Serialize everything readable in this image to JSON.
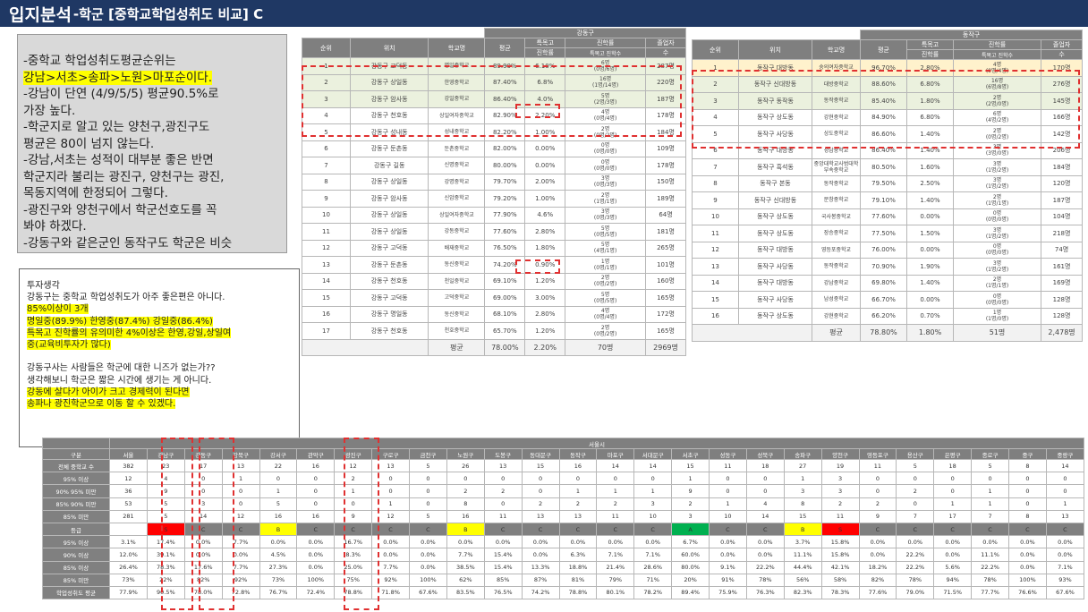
{
  "title": {
    "main": "입지분석",
    "sub": "-학군 [중학교학업성취도 비교] C"
  },
  "note": [
    "-중학교 학업성취도평균순위는",
    "강남>서초>송파>노원>마포순이다.",
    "-강남이 단연 (4/9/5/5) 평균90.5%로",
    "  가장 높다.",
    "-학군지로 알고 있는 양천구,광진구도",
    "  평균은 80이 넘지 않는다.",
    "-강남,서초는 성적이 대부분 좋은 반면",
    "  학군지라 불리는 광진구, 양천구는 광진,",
    "목동지역에 한정되어 그렇다.",
    "-광진구와 양천구에서 학군선호도를 꼭",
    "  봐야 하겠다.",
    "-강동구와 같은군인 동작구도 학군은 비슷"
  ],
  "investment": {
    "title": "투자생각",
    "lines": [
      "강동구는 중학교 학업성취도가 아주 좋은편은 아니다.",
      "85%이상이 3개",
      "명일중(89.9%) 한영중(87.4%) 강일중(86.4%)",
      "특목고 진학률의 유의미한 4%이상은 한영,강일,상일여",
      "중(교육비투자가 많다)",
      "",
      "강동구사는 사람들은 학군에 대한 니즈가 없는가??",
      "생각해보니 학군은 짧은 시간에 생기는 게 아니다.",
      "강동에 살다가 아이가 크고 경제력이 된다면",
      "송파나 광진학군으로 이동 할 수 있겠다."
    ]
  },
  "left_table": {
    "district": "강동구",
    "headers": {
      "rank": "순위",
      "loc": "위치",
      "school": "학교명",
      "avg": "평균",
      "special": "특목고",
      "special2": "진학률",
      "adv": "진학률",
      "adv2": "특목고 진학수",
      "adv3": "(과학고/외고국제고)",
      "grad": "졸업자",
      "grad2": "수"
    },
    "rows": [
      {
        "r": "1",
        "loc": "강동구 고덕동",
        "s": "명일중학교",
        "a": "89.90%",
        "p": "6.10%",
        "n": "6명",
        "n2": "(0명/6명)",
        "g": "287명"
      },
      {
        "r": "2",
        "loc": "강동구 상일동",
        "s": "한영중학교",
        "a": "87.40%",
        "p": "6.8%",
        "n": "16명",
        "n2": "(1명/14명)",
        "g": "220명"
      },
      {
        "r": "3",
        "loc": "강동구 암사동",
        "s": "강일중학교",
        "a": "86.40%",
        "p": "4.0%",
        "n": "5명",
        "n2": "(2명/3명)",
        "g": "187명"
      },
      {
        "r": "4",
        "loc": "강동구 천호동",
        "s": "상일여자중학교",
        "a": "82.90%",
        "p": "2.20%",
        "n": "4명",
        "n2": "(0명/4명)",
        "g": "178명"
      },
      {
        "r": "5",
        "loc": "강동구 성내동",
        "s": "성내중학교",
        "a": "82.20%",
        "p": "1.00%",
        "n": "2명",
        "n2": "(0명/2명)",
        "g": "184명"
      },
      {
        "r": "6",
        "loc": "강동구 둔촌동",
        "s": "둔촌중학교",
        "a": "82.00%",
        "p": "0.00%",
        "n": "0명",
        "n2": "(0명/0명)",
        "g": "109명"
      },
      {
        "r": "7",
        "loc": "강동구 길동",
        "s": "신명중학교",
        "a": "80.00%",
        "p": "0.00%",
        "n": "0명",
        "n2": "(0명/0명)",
        "g": "178명"
      },
      {
        "r": "8",
        "loc": "강동구 상일동",
        "s": "강명중학교",
        "a": "79.70%",
        "p": "2.00%",
        "n": "3명",
        "n2": "(0명/3명)",
        "g": "150명"
      },
      {
        "r": "9",
        "loc": "강동구 암사동",
        "s": "신암중학교",
        "a": "79.20%",
        "p": "1.00%",
        "n": "2명",
        "n2": "(1명/1명)",
        "g": "189명"
      },
      {
        "r": "10",
        "loc": "강동구 상일동",
        "s": "상일여자중학교",
        "a": "77.90%",
        "p": "4.6%",
        "n": "3명",
        "n2": "(0명/3명)",
        "g": "64명"
      },
      {
        "r": "11",
        "loc": "강동구 상일동",
        "s": "강동중학교",
        "a": "77.60%",
        "p": "2.80%",
        "n": "5명",
        "n2": "(0명/5명)",
        "g": "181명"
      },
      {
        "r": "12",
        "loc": "강동구 고덕동",
        "s": "배재중학교",
        "a": "76.50%",
        "p": "1.80%",
        "n": "5명",
        "n2": "(4명/1명)",
        "g": "265명"
      },
      {
        "r": "13",
        "loc": "강동구 둔촌동",
        "s": "동신중학교",
        "a": "74.20%",
        "p": "0.90%",
        "n": "1명",
        "n2": "(0명/1명)",
        "g": "101명"
      },
      {
        "r": "14",
        "loc": "강동구 천호동",
        "s": "천일중학교",
        "a": "69.10%",
        "p": "1.20%",
        "n": "2명",
        "n2": "(0명/2명)",
        "g": "160명"
      },
      {
        "r": "15",
        "loc": "강동구 고덕동",
        "s": "고덕중학교",
        "a": "69.00%",
        "p": "3.00%",
        "n": "5명",
        "n2": "(0명/5명)",
        "g": "165명"
      },
      {
        "r": "16",
        "loc": "강동구 명일동",
        "s": "동신중학교",
        "a": "68.10%",
        "p": "2.80%",
        "n": "4명",
        "n2": "(0명/4명)",
        "g": "172명"
      },
      {
        "r": "17",
        "loc": "강동구 천호동",
        "s": "천호중학교",
        "a": "65.70%",
        "p": "1.20%",
        "n": "2명",
        "n2": "(0명/2명)",
        "g": "165명"
      }
    ],
    "avg_label": "평균",
    "avg_val": "78.00%",
    "avg_p": "2.20%",
    "avg_n": "70명",
    "avg_g": "2969명"
  },
  "right_table": {
    "district": "동작구",
    "rows": [
      {
        "r": "1",
        "loc": "동작구 대방동",
        "s": "숭의여자중학교",
        "a": "96.70%",
        "p": "2.80%",
        "n": "4명",
        "n2": "(0명/4명)",
        "g": "170명"
      },
      {
        "r": "2",
        "loc": "동작구 신대방동",
        "s": "대방중학교",
        "a": "88.60%",
        "p": "6.80%",
        "n": "16명",
        "n2": "(6명/8명)",
        "g": "276명"
      },
      {
        "r": "3",
        "loc": "동작구 동작동",
        "s": "동작중학교",
        "a": "85.40%",
        "p": "1.80%",
        "n": "2명",
        "n2": "(2명/0명)",
        "g": "145명"
      },
      {
        "r": "4",
        "loc": "동작구 상도동",
        "s": "강현중학교",
        "a": "84.90%",
        "p": "6.80%",
        "n": "6명",
        "n2": "(4명/2명)",
        "g": "166명"
      },
      {
        "r": "5",
        "loc": "동작구 사당동",
        "s": "상도중학교",
        "a": "86.60%",
        "p": "1.40%",
        "n": "2명",
        "n2": "(0명/2명)",
        "g": "142명"
      },
      {
        "r": "6",
        "loc": "동작구 대방동",
        "s": "성남중학교",
        "a": "86.40%",
        "p": "1.40%",
        "n": "3명",
        "n2": "(3명/0명)",
        "g": "206명"
      },
      {
        "r": "7",
        "loc": "동작구 흑석동",
        "s": "중앙대학교사범대학부속중학교",
        "a": "80.50%",
        "p": "1.60%",
        "n": "3명",
        "n2": "(1명/2명)",
        "g": "184명"
      },
      {
        "r": "8",
        "loc": "동작구 본동",
        "s": "동작중학교",
        "a": "79.50%",
        "p": "2.50%",
        "n": "3명",
        "n2": "(1명/2명)",
        "g": "120명"
      },
      {
        "r": "9",
        "loc": "동작구 신대방동",
        "s": "문창중학교",
        "a": "79.10%",
        "p": "1.40%",
        "n": "2명",
        "n2": "(1명/1명)",
        "g": "187명"
      },
      {
        "r": "10",
        "loc": "동작구 상도동",
        "s": "국사봉중학교",
        "a": "77.60%",
        "p": "0.00%",
        "n": "0명",
        "n2": "(0명/0명)",
        "g": "104명"
      },
      {
        "r": "11",
        "loc": "동작구 상도동",
        "s": "장승중학교",
        "a": "77.50%",
        "p": "1.50%",
        "n": "3명",
        "n2": "(1명/2명)",
        "g": "218명"
      },
      {
        "r": "12",
        "loc": "동작구 대방동",
        "s": "영등포중학교",
        "a": "76.00%",
        "p": "0.00%",
        "n": "0명",
        "n2": "(0명/0명)",
        "g": "74명"
      },
      {
        "r": "13",
        "loc": "동작구 사당동",
        "s": "동작중학교",
        "a": "70.90%",
        "p": "1.90%",
        "n": "3명",
        "n2": "(1명/2명)",
        "g": "161명"
      },
      {
        "r": "14",
        "loc": "동작구 대방동",
        "s": "강남중학교",
        "a": "69.80%",
        "p": "1.40%",
        "n": "2명",
        "n2": "(1명/1명)",
        "g": "169명"
      },
      {
        "r": "15",
        "loc": "동작구 사당동",
        "s": "남성중학교",
        "a": "66.70%",
        "p": "0.00%",
        "n": "0명",
        "n2": "(0명/0명)",
        "g": "128명"
      },
      {
        "r": "16",
        "loc": "동작구 상도동",
        "s": "강현중학교",
        "a": "66.20%",
        "p": "0.70%",
        "n": "1명",
        "n2": "(1명/0명)",
        "g": "128명"
      }
    ],
    "avg_label": "평균",
    "avg_val": "78.80%",
    "avg_p": "1.80%",
    "avg_n": "51명",
    "avg_g": "2,478명"
  },
  "bottom_table": {
    "city": "서울시",
    "first_col": "구분",
    "districts": [
      "서울",
      "강남구",
      "강동구",
      "강북구",
      "강서구",
      "관악구",
      "광진구",
      "구로구",
      "금천구",
      "노원구",
      "도봉구",
      "동대문구",
      "동작구",
      "마포구",
      "서대문구",
      "서초구",
      "성동구",
      "성북구",
      "송파구",
      "양천구",
      "영등포구",
      "용산구",
      "은평구",
      "종로구",
      "중구",
      "중랑구"
    ],
    "rows": [
      {
        "label": "전체 중학교 수",
        "vals": [
          "382",
          "23",
          "17",
          "13",
          "22",
          "16",
          "12",
          "13",
          "5",
          "26",
          "13",
          "15",
          "16",
          "14",
          "14",
          "15",
          "11",
          "18",
          "27",
          "19",
          "11",
          "5",
          "18",
          "5",
          "8",
          "14"
        ]
      },
      {
        "label": "95% 이상",
        "vals": [
          "12",
          "4",
          "0",
          "1",
          "0",
          "0",
          "2",
          "0",
          "0",
          "0",
          "0",
          "0",
          "0",
          "0",
          "0",
          "1",
          "0",
          "0",
          "1",
          "3",
          "0",
          "0",
          "0",
          "0",
          "0",
          "0"
        ]
      },
      {
        "label": "90% 95% 미만",
        "vals": [
          "36",
          "9",
          "0",
          "0",
          "1",
          "0",
          "1",
          "0",
          "0",
          "2",
          "2",
          "0",
          "1",
          "1",
          "1",
          "9",
          "0",
          "0",
          "3",
          "3",
          "0",
          "2",
          "0",
          "1",
          "0",
          "0"
        ]
      },
      {
        "label": "85% 90% 미만",
        "vals": [
          "53",
          "5",
          "3",
          "0",
          "5",
          "0",
          "0",
          "1",
          "0",
          "8",
          "0",
          "2",
          "2",
          "2",
          "3",
          "2",
          "1",
          "4",
          "8",
          "2",
          "2",
          "0",
          "1",
          "1",
          "0",
          "1"
        ]
      },
      {
        "label": "85% 미만",
        "vals": [
          "281",
          "5",
          "14",
          "12",
          "16",
          "16",
          "9",
          "12",
          "5",
          "16",
          "11",
          "13",
          "13",
          "11",
          "10",
          "3",
          "10",
          "14",
          "15",
          "11",
          "9",
          "7",
          "17",
          "7",
          "8",
          "13"
        ]
      },
      {
        "label": "등급",
        "vals": [
          "",
          "S",
          "C",
          "C",
          "B",
          "C",
          "C",
          "C",
          "C",
          "B",
          "C",
          "C",
          "C",
          "C",
          "C",
          "A",
          "C",
          "C",
          "B",
          "S",
          "C",
          "C",
          "C",
          "C",
          "C",
          "C"
        ],
        "grade": true
      },
      {
        "label": "95% 이상",
        "vals": [
          "3.1%",
          "17.4%",
          "0.0%",
          "7.7%",
          "0.0%",
          "0.0%",
          "16.7%",
          "0.0%",
          "0.0%",
          "0.0%",
          "0.0%",
          "0.0%",
          "0.0%",
          "0.0%",
          "0.0%",
          "6.7%",
          "0.0%",
          "0.0%",
          "3.7%",
          "15.8%",
          "0.0%",
          "0.0%",
          "0.0%",
          "0.0%",
          "0.0%",
          "0.0%"
        ]
      },
      {
        "label": "90% 이상",
        "vals": [
          "12.0%",
          "39.1%",
          "0.0%",
          "0.0%",
          "4.5%",
          "0.0%",
          "8.3%",
          "0.0%",
          "0.0%",
          "7.7%",
          "15.4%",
          "0.0%",
          "6.3%",
          "7.1%",
          "7.1%",
          "60.0%",
          "0.0%",
          "0.0%",
          "11.1%",
          "15.8%",
          "0.0%",
          "22.2%",
          "0.0%",
          "11.1%",
          "0.0%",
          "0.0%"
        ]
      },
      {
        "label": "85% 이상",
        "vals": [
          "26.4%",
          "78.3%",
          "17.6%",
          "7.7%",
          "27.3%",
          "0.0%",
          "25.0%",
          "7.7%",
          "0.0%",
          "38.5%",
          "15.4%",
          "13.3%",
          "18.8%",
          "21.4%",
          "28.6%",
          "80.0%",
          "9.1%",
          "22.2%",
          "44.4%",
          "42.1%",
          "18.2%",
          "22.2%",
          "5.6%",
          "22.2%",
          "0.0%",
          "7.1%"
        ]
      },
      {
        "label": "85% 미만",
        "vals": [
          "73%",
          "22%",
          "82%",
          "92%",
          "73%",
          "100%",
          "75%",
          "92%",
          "100%",
          "62%",
          "85%",
          "87%",
          "81%",
          "79%",
          "71%",
          "20%",
          "91%",
          "78%",
          "56%",
          "58%",
          "82%",
          "78%",
          "94%",
          "78%",
          "100%",
          "93%"
        ]
      },
      {
        "label": "학업성취도 평균",
        "vals": [
          "77.9%",
          "90.5%",
          "78.0%",
          "72.8%",
          "76.7%",
          "72.4%",
          "78.8%",
          "71.8%",
          "67.6%",
          "83.5%",
          "76.5%",
          "74.2%",
          "78.8%",
          "80.1%",
          "78.2%",
          "89.4%",
          "75.9%",
          "76.3%",
          "82.3%",
          "78.3%",
          "77.6%",
          "79.0%",
          "71.5%",
          "77.7%",
          "76.6%",
          "67.6%"
        ]
      }
    ]
  },
  "colors": {
    "title_bg": "#1f3864",
    "highlight": "#ffff00",
    "red_box": "#e03030",
    "grade_S": "#ff0000",
    "grade_B": "#ffff00",
    "grade_A": "#00b050"
  }
}
